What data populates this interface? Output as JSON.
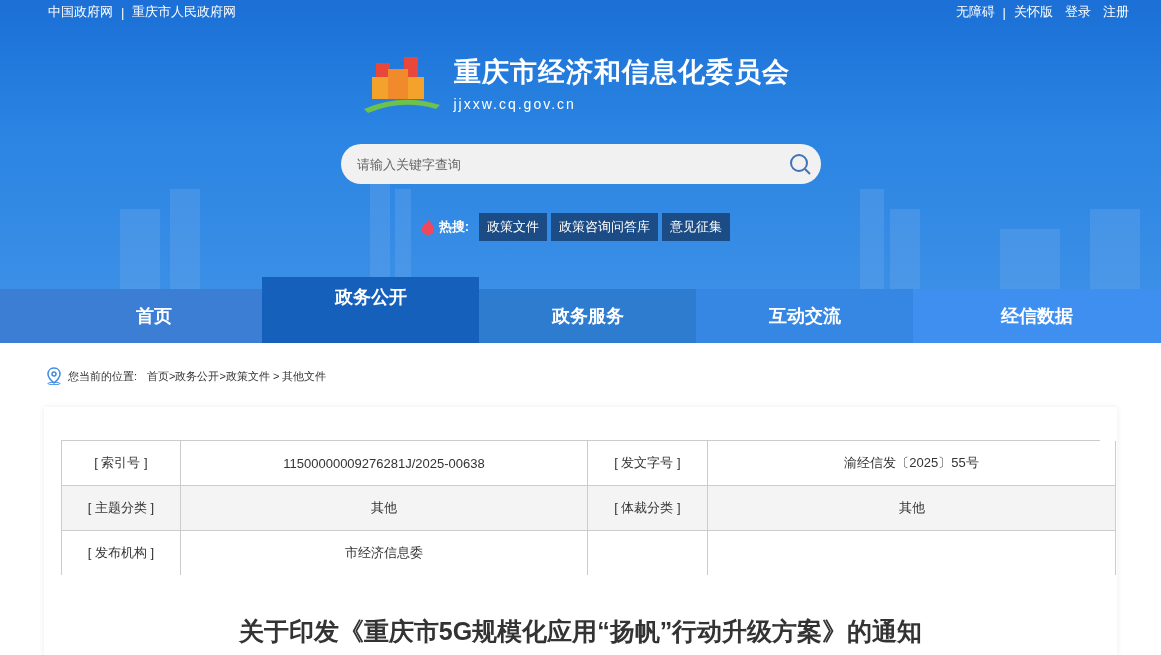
{
  "top_links_left": [
    "中国政府网",
    "重庆市人民政府网"
  ],
  "top_links_right": [
    "无障碍",
    "关怀版",
    "登录",
    "注册"
  ],
  "top_links_separator": "|",
  "site": {
    "name": "重庆市经济和信息化委员会",
    "domain": "jjxxw.cq.gov.cn"
  },
  "search": {
    "placeholder": "请输入关键字查询"
  },
  "hot_search": {
    "label": "热搜:",
    "items": [
      "政策文件",
      "政策咨询问答库",
      "意见征集"
    ]
  },
  "nav": [
    {
      "label": "首页",
      "selected": false
    },
    {
      "label": "政务公开",
      "selected": true
    },
    {
      "label": "政务服务",
      "selected": false
    },
    {
      "label": "互动交流",
      "selected": false
    },
    {
      "label": "经信数据",
      "selected": false
    }
  ],
  "breadcrumb": {
    "label": "您当前的位置:",
    "path": "首页>政务公开>政策文件 > 其他文件"
  },
  "info_table": [
    [
      "[ 索引号 ]",
      "11500000009276281J/2025-00638",
      "[ 发文字号 ]",
      "渝经信发〔2025〕55号"
    ],
    [
      "[ 主题分类 ]",
      "其他",
      "[ 体裁分类 ]",
      "其他"
    ],
    [
      "[ 发布机构 ]",
      "市经济信息委"
    ]
  ],
  "article_title": "关于印发《重庆市5G规模化应用“扬帆”行动升级方案》的通知"
}
